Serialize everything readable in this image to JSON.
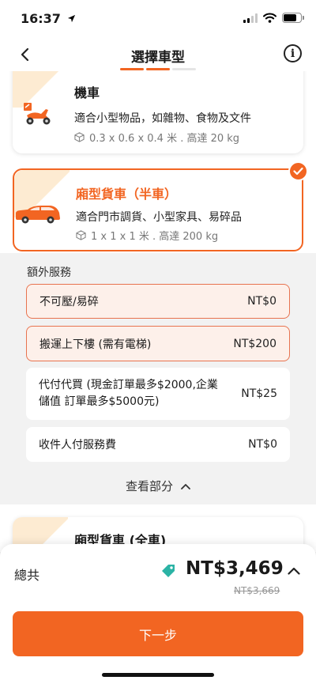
{
  "status_bar": {
    "time": "16:37"
  },
  "header": {
    "title": "選擇車型"
  },
  "vehicles": [
    {
      "name": "機車",
      "description": "適合小型物品，如雜物、食物及文件",
      "dimensions": "0.3 x 0.6 x 0.4 米 . 高達 20 kg",
      "selected": false
    },
    {
      "name": "廂型貨車（半車）",
      "description": "適合門市調貨、小型家具、易碎品",
      "dimensions": "1 x 1 x 1 米 . 高達 200 kg",
      "selected": true
    },
    {
      "name": "廂型貨車 (全車)",
      "selected": false
    }
  ],
  "extras": {
    "title": "額外服務",
    "items": [
      {
        "label": "不可壓/易碎",
        "price": "NT$0",
        "active": true
      },
      {
        "label": "搬運上下樓 (需有電梯)",
        "price": "NT$200",
        "active": true
      },
      {
        "label": "代付代買 (現金訂單最多$2000,企業儲值 訂單最多$5000元)",
        "price": "NT$25",
        "active": false
      },
      {
        "label": "收件人付服務費",
        "price": "NT$0",
        "active": false
      }
    ],
    "see_more": "查看部分"
  },
  "summary": {
    "total_label": "總共",
    "total_price": "NT$3,469",
    "original_price": "NT$3,669",
    "next_label": "下一步"
  },
  "colors": {
    "accent": "#f26522",
    "tag": "#2bb3a5",
    "selected_row_bg": "#fdf0ea"
  }
}
